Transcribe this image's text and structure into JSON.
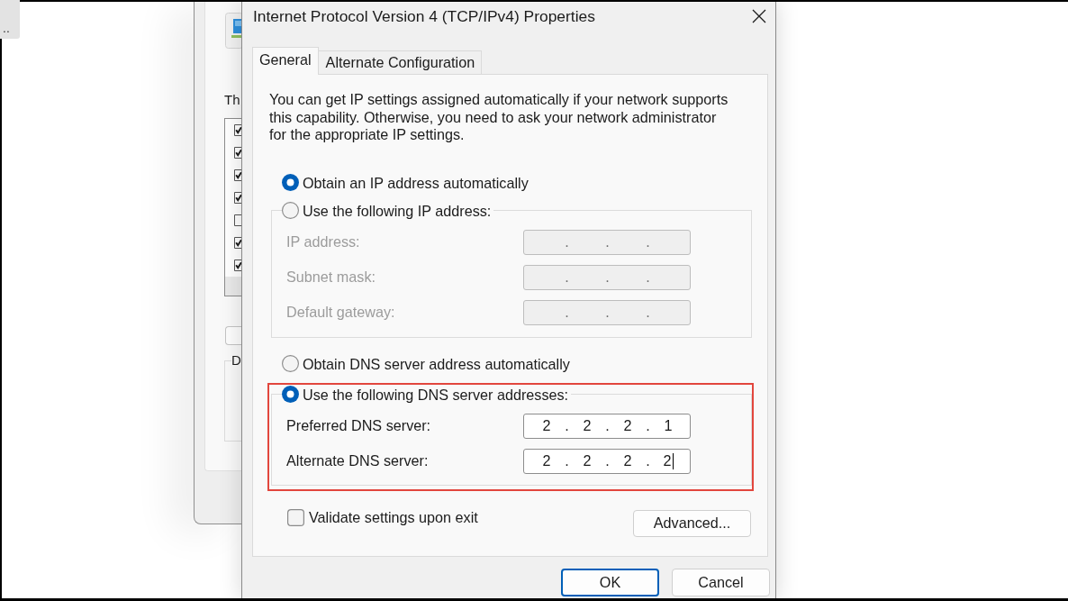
{
  "desktop_tile": {
    "label": ".."
  },
  "back_window": {
    "label": "Th",
    "components": [
      {
        "checked": true
      },
      {
        "checked": true
      },
      {
        "checked": true
      },
      {
        "checked": true
      },
      {
        "checked": false
      },
      {
        "checked": true
      },
      {
        "checked": true
      }
    ],
    "group_label": "D"
  },
  "dialog": {
    "title": "Internet Protocol Version 4 (TCP/IPv4) Properties",
    "tabs": [
      {
        "label": "General",
        "selected": true
      },
      {
        "label": "Alternate Configuration",
        "selected": false
      }
    ],
    "description": "You can get IP settings assigned automatically if your network supports this capability. Otherwise, you need to ask your network administrator for the appropriate IP settings.",
    "ip_options": [
      {
        "label": "Obtain an IP address automatically",
        "selected": true
      },
      {
        "label": "Use the following IP address:",
        "selected": false
      }
    ],
    "ip_fields": [
      {
        "label": "IP address:",
        "disabled": true,
        "focused": false
      },
      {
        "label": "Subnet mask:",
        "disabled": true,
        "focused": false
      },
      {
        "label": "Default gateway:",
        "disabled": true,
        "focused": false
      }
    ],
    "dns_options": [
      {
        "label": "Obtain DNS server address automatically",
        "selected": false
      },
      {
        "label": "Use the following DNS server addresses:",
        "selected": true
      }
    ],
    "dns_highlighted": true,
    "dns_fields": [
      {
        "label": "Preferred DNS server:",
        "octets": [
          "2",
          "2",
          "2",
          "1"
        ],
        "disabled": false,
        "focused": false
      },
      {
        "label": "Alternate DNS server:",
        "octets": [
          "2",
          "2",
          "2",
          "2"
        ],
        "disabled": false,
        "focused": true
      }
    ],
    "octet_separator": ".",
    "validate_option": {
      "label": "Validate settings upon exit",
      "checked": false
    },
    "advanced_button": "Advanced...",
    "buttons": [
      {
        "label": "OK",
        "default": true
      },
      {
        "label": "Cancel",
        "default": false
      }
    ]
  }
}
